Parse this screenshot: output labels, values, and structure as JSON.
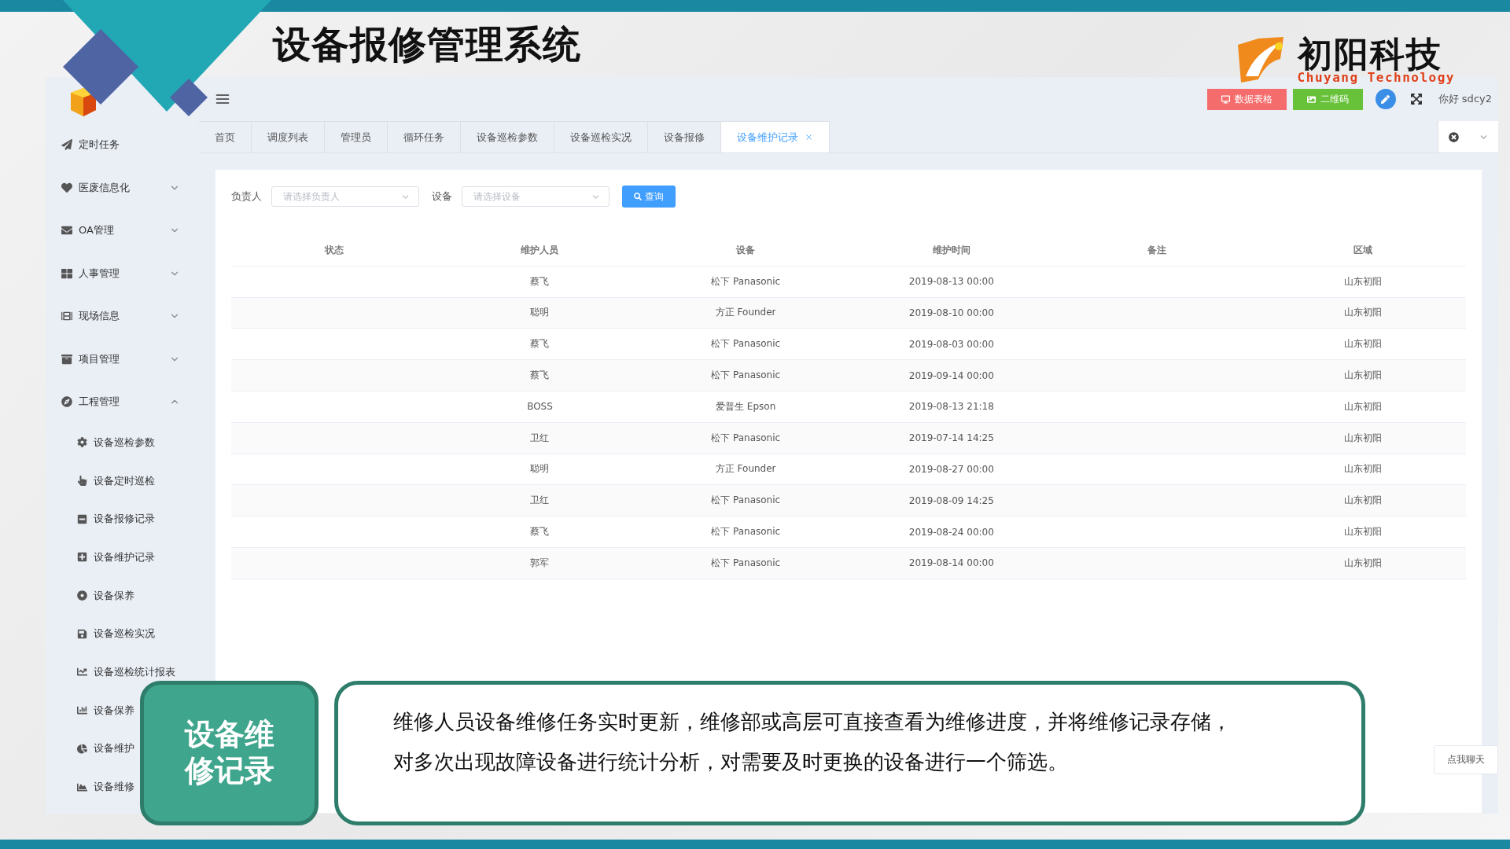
{
  "slide_title": "设备报修管理系统",
  "brand": {
    "name": "初阳科技",
    "subtitle": "Chuyang Technology"
  },
  "header": {
    "buttons": [
      {
        "label": "数据表格",
        "kind": "table"
      },
      {
        "label": "二维码",
        "kind": "qr"
      }
    ],
    "greeting": "你好 sdcy2"
  },
  "sidebar": {
    "items": [
      {
        "label": "定时任务"
      },
      {
        "label": "医废信息化",
        "expanded": false
      },
      {
        "label": "OA管理",
        "expanded": false
      },
      {
        "label": "人事管理",
        "expanded": false
      },
      {
        "label": "现场信息",
        "expanded": false
      },
      {
        "label": "项目管理",
        "expanded": false
      },
      {
        "label": "工程管理",
        "expanded": true,
        "children": [
          {
            "label": "设备巡检参数"
          },
          {
            "label": "设备定时巡检"
          },
          {
            "label": "设备报修记录"
          },
          {
            "label": "设备维护记录"
          },
          {
            "label": "设备保养"
          },
          {
            "label": "设备巡检实况"
          },
          {
            "label": "设备巡检统计报表"
          },
          {
            "label": "设备保养"
          },
          {
            "label": "设备维护"
          },
          {
            "label": "设备维修"
          }
        ]
      }
    ]
  },
  "tabs": [
    {
      "label": "首页",
      "selected": false
    },
    {
      "label": "调度列表",
      "selected": false
    },
    {
      "label": "管理员",
      "selected": false
    },
    {
      "label": "循环任务",
      "selected": false
    },
    {
      "label": "设备巡检参数",
      "selected": false
    },
    {
      "label": "设备巡检实况",
      "selected": false
    },
    {
      "label": "设备报修",
      "selected": false
    },
    {
      "label": "设备维护记录",
      "selected": true,
      "closable": true
    }
  ],
  "filters": [
    {
      "label": "负责人",
      "placeholder": "请选择负责人"
    },
    {
      "label": "设备",
      "placeholder": "请选择设备"
    }
  ],
  "search_button": "查询",
  "table": {
    "columns": [
      "状态",
      "维护人员",
      "设备",
      "维护时间",
      "备注",
      "区域"
    ],
    "rows": [
      [
        "",
        "蔡飞",
        "松下 Panasonic",
        "2019-08-13 00:00",
        "",
        "山东初阳"
      ],
      [
        "",
        "聪明",
        "方正 Founder",
        "2019-08-10 00:00",
        "",
        "山东初阳"
      ],
      [
        "",
        "蔡飞",
        "松下 Panasonic",
        "2019-08-03 00:00",
        "",
        "山东初阳"
      ],
      [
        "",
        "蔡飞",
        "松下 Panasonic",
        "2019-09-14 00:00",
        "",
        "山东初阳"
      ],
      [
        "",
        "BOSS",
        "爱普生 Epson",
        "2019-08-13 21:18",
        "",
        "山东初阳"
      ],
      [
        "",
        "卫红",
        "松下 Panasonic",
        "2019-07-14 14:25",
        "",
        "山东初阳"
      ],
      [
        "",
        "聪明",
        "方正 Founder",
        "2019-08-27 00:00",
        "",
        "山东初阳"
      ],
      [
        "",
        "卫红",
        "松下 Panasonic",
        "2019-08-09 14:25",
        "",
        "山东初阳"
      ],
      [
        "",
        "蔡飞",
        "松下 Panasonic",
        "2019-08-24 00:00",
        "",
        "山东初阳"
      ],
      [
        "",
        "郭军",
        "松下 Panasonic",
        "2019-08-14 00:00",
        "",
        "山东初阳"
      ]
    ]
  },
  "chat_button": "点我聊天",
  "callout": {
    "label": "设备维修记录",
    "lines": [
      "维修人员设备维修任务实时更新，维修部或高层可直接查看为维修进度，并将维修记录存储，",
      "对多次出现故障设备进行统计分析，对需要及时更换的设备进行一个筛选。"
    ]
  }
}
